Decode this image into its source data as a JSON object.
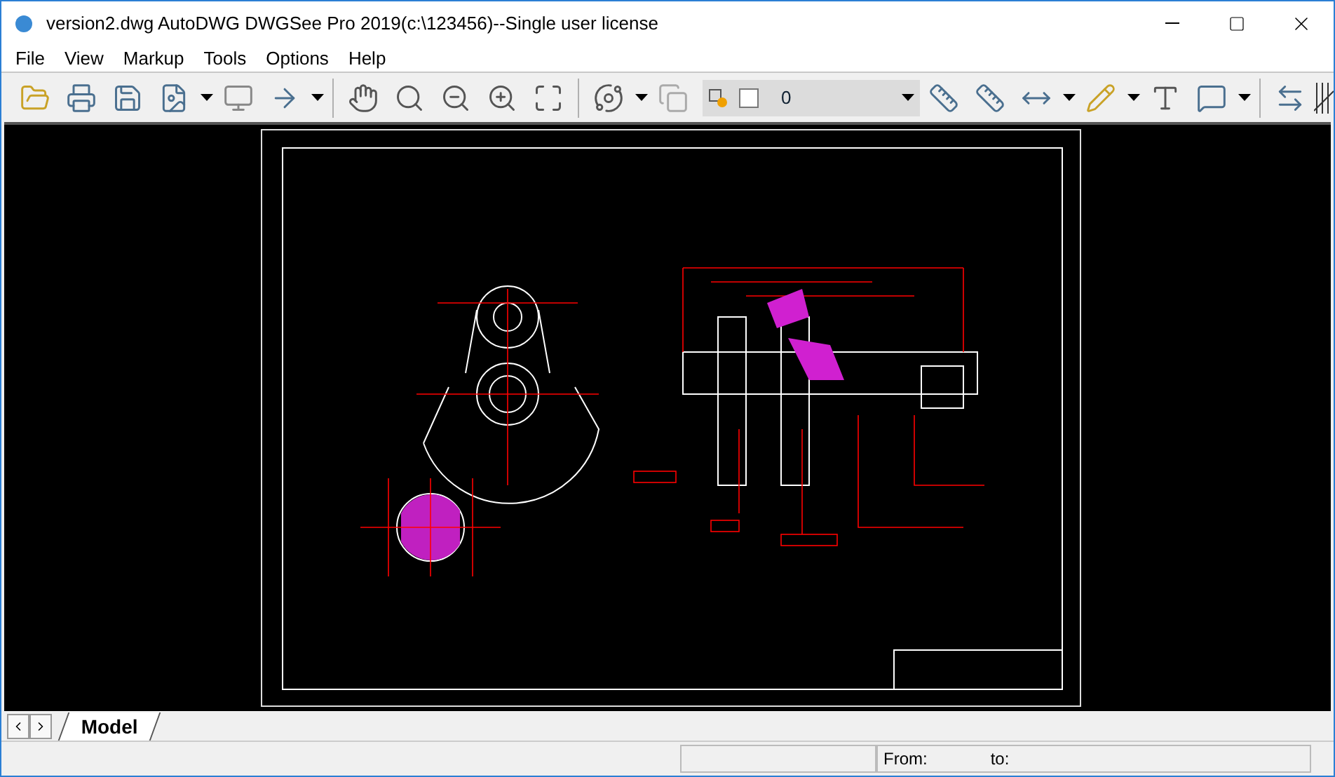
{
  "window": {
    "title": "version2.dwg AutoDWG DWGSee Pro 2019(c:\\123456)--Single user license"
  },
  "menu": [
    "File",
    "View",
    "Markup",
    "Tools",
    "Options",
    "Help"
  ],
  "layer": {
    "value": "0"
  },
  "tabs": [
    {
      "label": "Model",
      "selected": true
    }
  ],
  "status_bar": {
    "from": "From:",
    "to": "to:"
  }
}
